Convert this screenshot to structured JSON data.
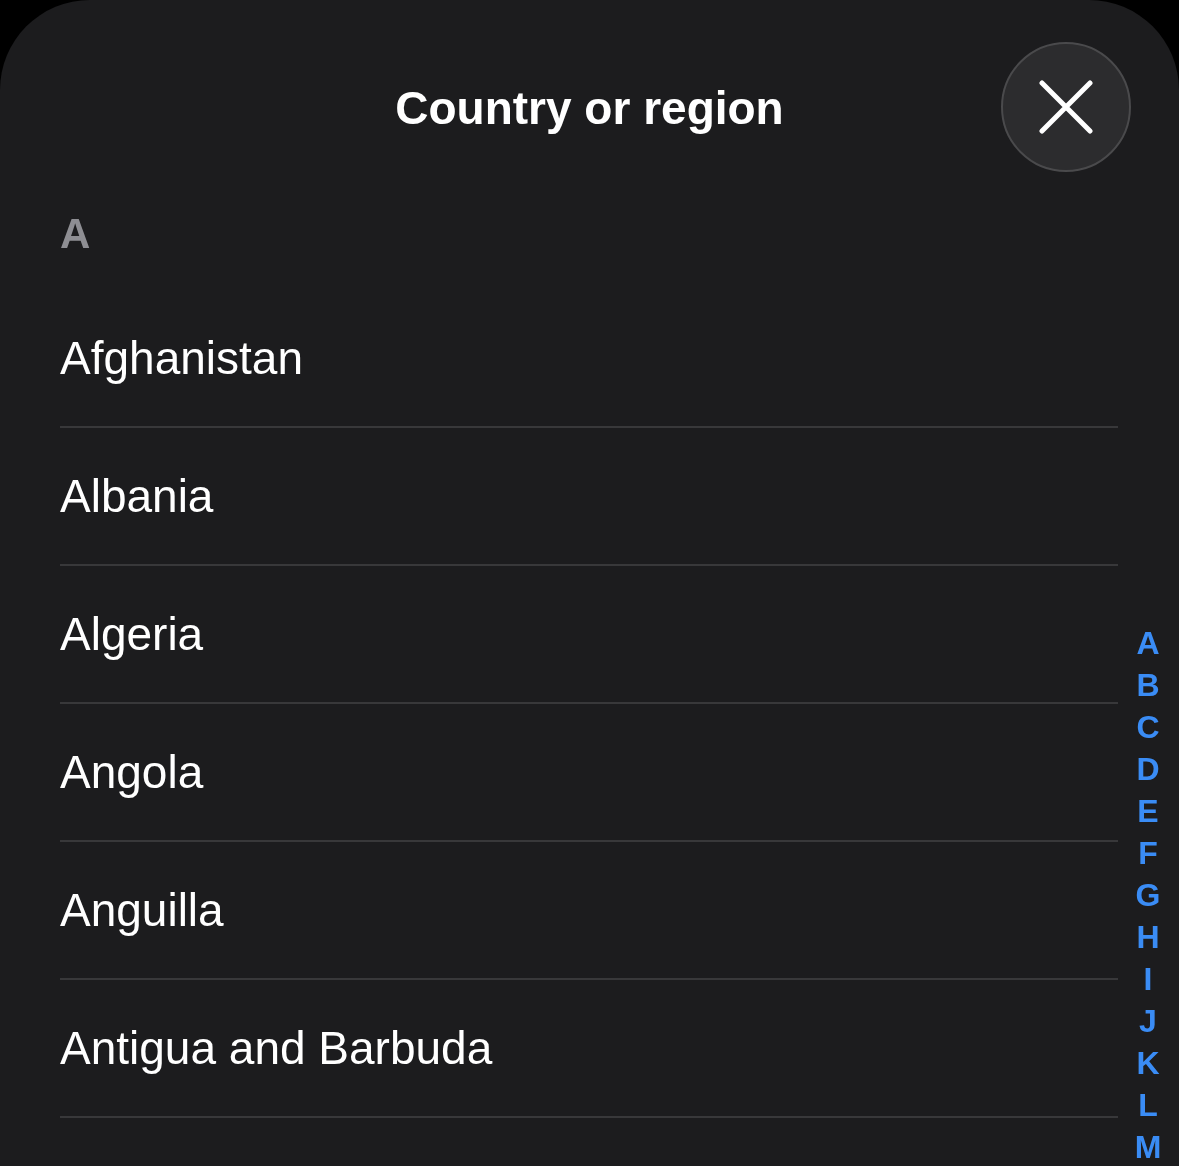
{
  "sheet": {
    "title": "Country or region"
  },
  "sections": [
    {
      "header": "A",
      "rows": [
        {
          "label": "Afghanistan"
        },
        {
          "label": "Albania"
        },
        {
          "label": "Algeria"
        },
        {
          "label": "Angola"
        },
        {
          "label": "Anguilla"
        },
        {
          "label": "Antigua and Barbuda"
        }
      ]
    }
  ],
  "index": [
    "A",
    "B",
    "C",
    "D",
    "E",
    "F",
    "G",
    "H",
    "I",
    "J",
    "K",
    "L",
    "M"
  ]
}
